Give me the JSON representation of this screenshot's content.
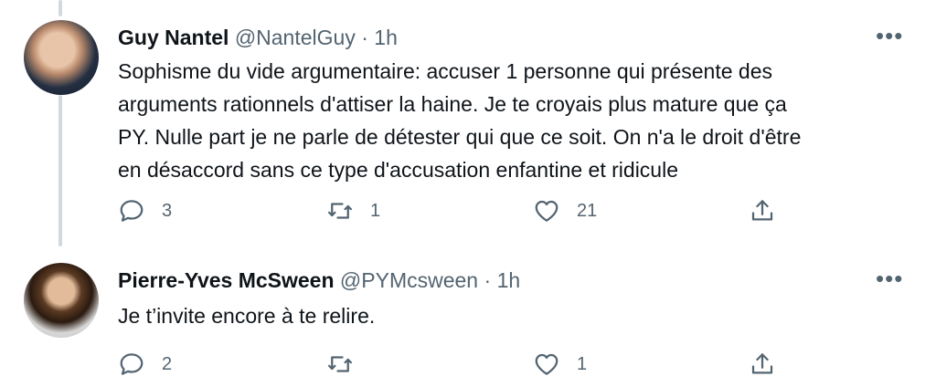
{
  "tweets": [
    {
      "name": "Guy Nantel",
      "handle": "@NantelGuy",
      "separator": "·",
      "time": "1h",
      "text": "Sophisme du vide argumentaire: accuser 1 personne qui présente des arguments rationnels d'attiser la haine. Je te croyais plus mature que ça PY. Nulle part je ne parle de détester qui que ce soit. On n'a le droit d'être en désaccord sans ce type d'accusation enfantine et ridicule",
      "lines": [
        "Sophisme du vide argumentaire: accuser 1 personne qui présente des",
        "arguments rationnels d'attiser la haine. Je te croyais plus mature que ça",
        "PY. Nulle part je ne parle de détester qui que ce soit. On n'a le droit d'être",
        "en désaccord sans ce type d'accusation enfantine et ridicule"
      ],
      "replies": "3",
      "retweets": "1",
      "likes": "21",
      "more": "•••"
    },
    {
      "name": "Pierre-Yves McSween",
      "handle": "@PYMcsween",
      "separator": "·",
      "time": "1h",
      "lines": [
        "Je t’invite encore à te relire."
      ],
      "replies": "2",
      "retweets": "",
      "likes": "1",
      "more": "•••"
    }
  ],
  "icons": {
    "reply": "reply-icon",
    "retweet": "retweet-icon",
    "like": "heart-icon",
    "share": "share-icon",
    "more": "more-icon"
  },
  "colors": {
    "text": "#0f1419",
    "secondary": "#536471",
    "line": "#cfd9de"
  }
}
